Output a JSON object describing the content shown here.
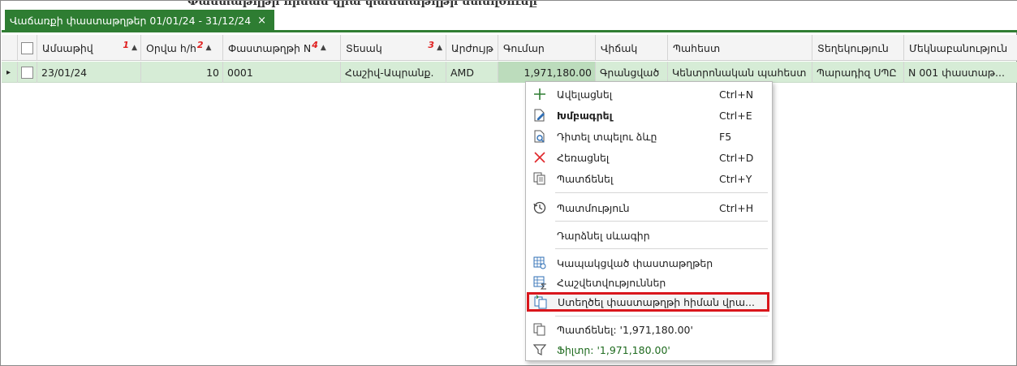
{
  "top_strip": "Փաստաթղթի հիման վրա փաստաթղթի ստեղծումը",
  "tab": {
    "title": "Վաճառքի փաստաթղթեր 01/01/24 - 31/12/24",
    "close": "×"
  },
  "columns": [
    {
      "label": "Ամսաթիվ",
      "sort_num": "1",
      "sort_arrow": "▲"
    },
    {
      "label": "Օրվա հ/հ",
      "sort_num": "2",
      "sort_arrow": "▲"
    },
    {
      "label": "Փաստաթղթի N",
      "sort_num": "4",
      "sort_arrow": "▲"
    },
    {
      "label": "Տեսակ",
      "sort_num": "3",
      "sort_arrow": "▲"
    },
    {
      "label": "Արժույթ"
    },
    {
      "label": "Գումար"
    },
    {
      "label": "Վիճակ"
    },
    {
      "label": "Պահեստ"
    },
    {
      "label": "Տեղեկություն"
    },
    {
      "label": "Մեկնաբանություն"
    }
  ],
  "row": {
    "indicator": "▸",
    "date": "23/01/24",
    "day_no": "10",
    "doc_no": "0001",
    "type": "Հաշիվ-Ապրանք.",
    "currency": "AMD",
    "amount": "1,971,180.00",
    "status": "Գրանցված",
    "warehouse": "Կենտրոնական պահեստ",
    "info": "Պարադիզ ՍՊԸ",
    "comment": "N 001 փաստաթ..."
  },
  "context_menu": {
    "items": [
      {
        "label": "Ավելացնել",
        "shortcut": "Ctrl+N",
        "icon": "plus-icon"
      },
      {
        "label": "Խմբագրել",
        "shortcut": "Ctrl+E",
        "icon": "edit-icon"
      },
      {
        "label": "Դիտել տպելու ձևը",
        "shortcut": "F5",
        "icon": "preview-icon"
      },
      {
        "label": "Հեռացնել",
        "shortcut": "Ctrl+D",
        "icon": "delete-icon"
      },
      {
        "label": "Պատճենել",
        "shortcut": "Ctrl+Y",
        "icon": "copy-icon"
      },
      {
        "label": "Պատմություն",
        "shortcut": "Ctrl+H",
        "icon": "history-icon"
      },
      {
        "label": "Դարձնել սևագիր",
        "shortcut": "",
        "icon": ""
      },
      {
        "label": "Կապակցված փաստաթղթեր",
        "shortcut": "",
        "icon": "linked-docs-icon"
      },
      {
        "label": "Հաշվետվություններ",
        "shortcut": "",
        "icon": "reports-icon"
      },
      {
        "label": "Ստեղծել փաստաթղթի հիման վրա...",
        "shortcut": "",
        "icon": "create-from-doc-icon"
      },
      {
        "label": "Պատճենել: '1,971,180.00'",
        "shortcut": "",
        "icon": "copy-value-icon"
      },
      {
        "label": "Ֆիլտր: '1,971,180.00'",
        "shortcut": "",
        "icon": "filter-icon"
      }
    ]
  },
  "colors": {
    "accent": "#2e7d32",
    "row_bg": "#d6ecd6",
    "highlight_border": "#d9161c"
  }
}
